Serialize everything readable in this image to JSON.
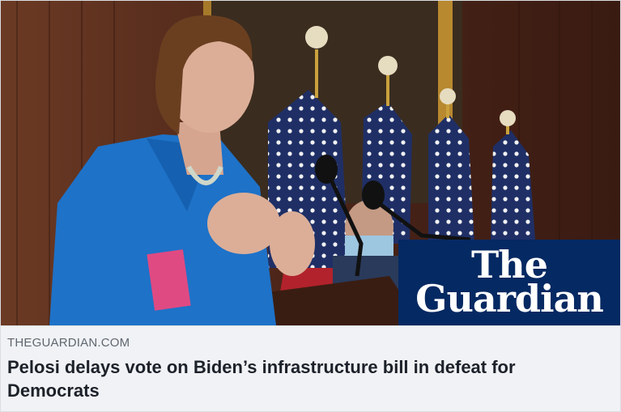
{
  "link_card": {
    "image": {
      "description": "",
      "brand_line_1": "The",
      "brand_line_2": "Guardian",
      "brand_color": "#052962"
    },
    "domain": "THEGUARDIAN.COM",
    "headline": "Pelosi delays vote on Biden’s infrastructure bill in defeat for Democrats"
  }
}
